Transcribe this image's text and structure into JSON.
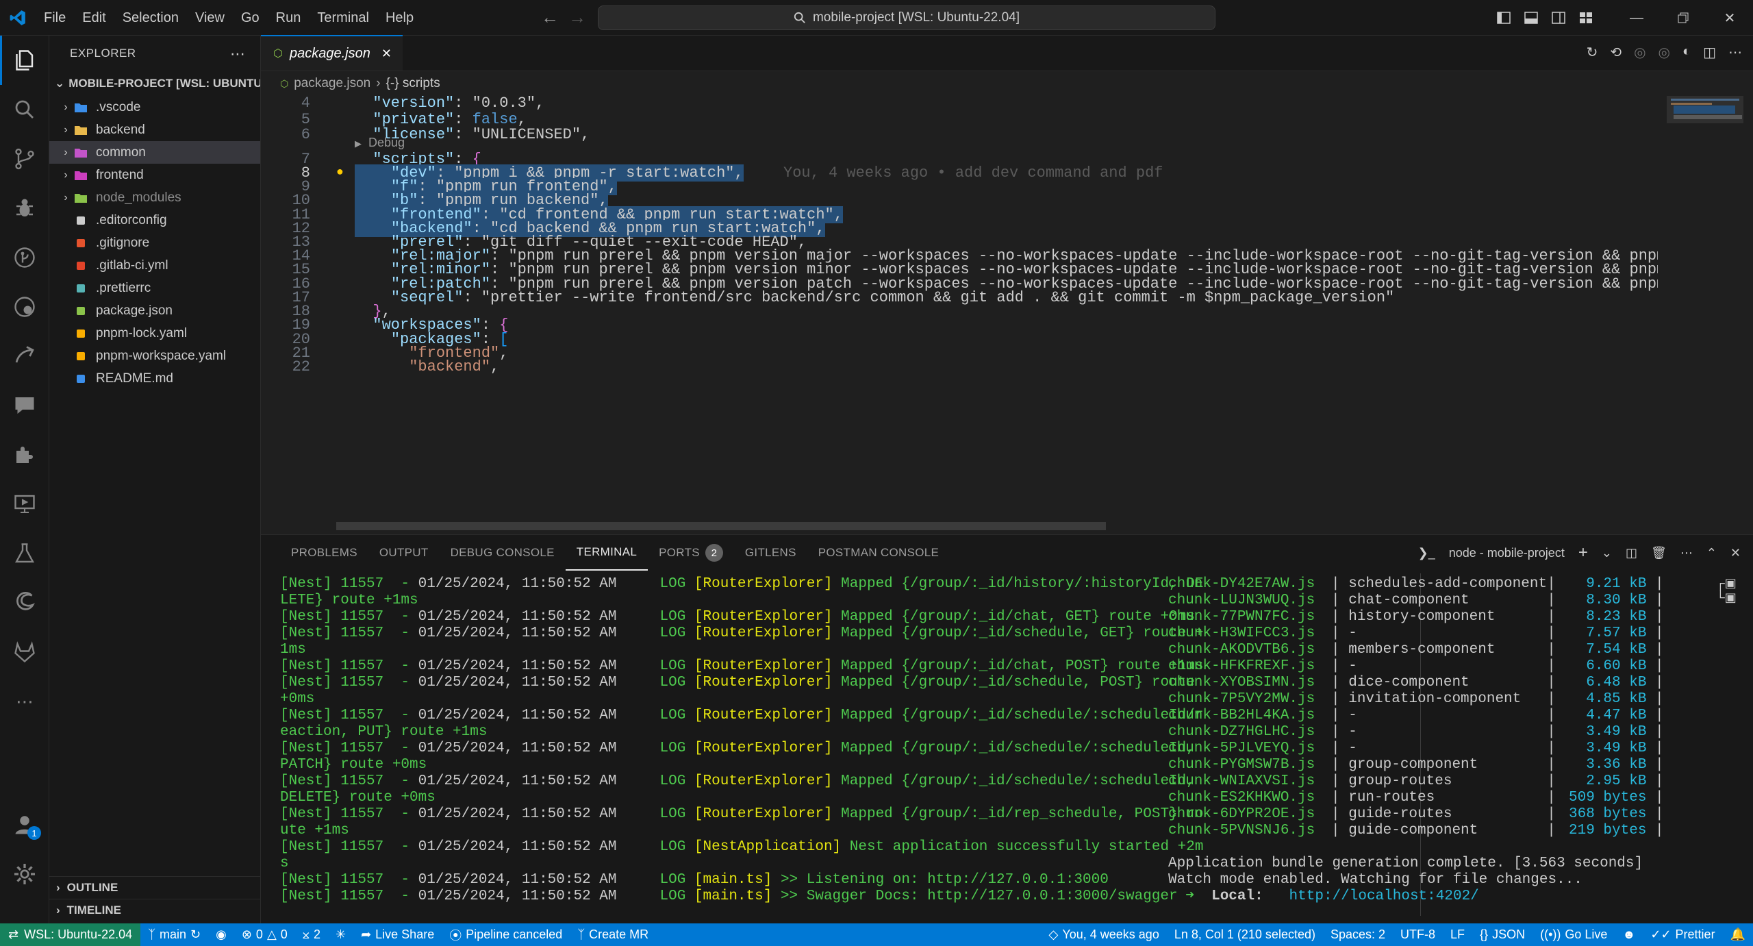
{
  "titlebar": {
    "menus": [
      "File",
      "Edit",
      "Selection",
      "View",
      "Go",
      "Run",
      "Terminal",
      "Help"
    ],
    "search": "mobile-project [WSL: Ubuntu-22.04]"
  },
  "sidebar": {
    "title": "EXPLORER",
    "root": "MOBILE-PROJECT [WSL: UBUNTU...",
    "items": [
      {
        "label": ".vscode",
        "type": "folder",
        "icon": "vscode-folder-icon",
        "color": "#3b8eea"
      },
      {
        "label": "backend",
        "type": "folder",
        "icon": "folder-icon",
        "color": "#e8b84b"
      },
      {
        "label": "common",
        "type": "folder",
        "icon": "folder-icon",
        "color": "#c354c9"
      },
      {
        "label": "frontend",
        "type": "folder",
        "icon": "folder-icon",
        "color": "#cc3ebe"
      },
      {
        "label": "node_modules",
        "type": "folder",
        "icon": "node-folder-icon",
        "color": "#8bc34a"
      },
      {
        "label": ".editorconfig",
        "type": "file",
        "icon": "editorconfig-icon",
        "color": "#cccccc"
      },
      {
        "label": ".gitignore",
        "type": "file",
        "icon": "git-icon",
        "color": "#e5532d"
      },
      {
        "label": ".gitlab-ci.yml",
        "type": "file",
        "icon": "gitlab-icon",
        "color": "#e24329"
      },
      {
        "label": ".prettierrc",
        "type": "file",
        "icon": "prettier-icon",
        "color": "#56b3b4"
      },
      {
        "label": "package.json",
        "type": "file",
        "icon": "nodejs-icon",
        "color": "#8bc34a"
      },
      {
        "label": "pnpm-lock.yaml",
        "type": "file",
        "icon": "pnpm-icon",
        "color": "#f9ad00"
      },
      {
        "label": "pnpm-workspace.yaml",
        "type": "file",
        "icon": "pnpm-icon",
        "color": "#f9ad00"
      },
      {
        "label": "README.md",
        "type": "file",
        "icon": "info-icon",
        "color": "#3b8eea"
      }
    ],
    "outline": "OUTLINE",
    "timeline": "TIMELINE"
  },
  "editor": {
    "tab": "package.json",
    "breadcrumb": [
      "package.json",
      "{-} scripts"
    ],
    "codelens": "Debug",
    "blame": "You, 4 weeks ago • add dev command and pdf"
  },
  "code": [
    {
      "n": "4",
      "t": "  \"version\": \"0.0.3\","
    },
    {
      "n": "5",
      "t": "  \"private\": false,"
    },
    {
      "n": "6",
      "t": "  \"license\": \"UNLICENSED\","
    },
    {
      "n": "7",
      "t": "  \"scripts\": {"
    },
    {
      "n": "8",
      "t": "    \"dev\": \"pnpm i && pnpm -r start:watch\","
    },
    {
      "n": "9",
      "t": "    \"f\": \"pnpm run frontend\","
    },
    {
      "n": "10",
      "t": "    \"b\": \"pnpm run backend\","
    },
    {
      "n": "11",
      "t": "    \"frontend\": \"cd frontend && pnpm run start:watch\","
    },
    {
      "n": "12",
      "t": "    \"backend\": \"cd backend && pnpm run start:watch\","
    },
    {
      "n": "13",
      "t": "    \"prerel\": \"git diff --quiet --exit-code HEAD\","
    },
    {
      "n": "14",
      "t": "    \"rel:major\": \"pnpm run prerel && pnpm version major --workspaces --no-workspaces-update --include-workspace-root --no-git-tag-version && pnpm"
    },
    {
      "n": "15",
      "t": "    \"rel:minor\": \"pnpm run prerel && pnpm version minor --workspaces --no-workspaces-update --include-workspace-root --no-git-tag-version && pnpm"
    },
    {
      "n": "16",
      "t": "    \"rel:patch\": \"pnpm run prerel && pnpm version patch --workspaces --no-workspaces-update --include-workspace-root --no-git-tag-version && pnpm"
    },
    {
      "n": "17",
      "t": "    \"seqrel\": \"prettier --write frontend/src backend/src common && git add . && git commit -m $npm_package_version\""
    },
    {
      "n": "18",
      "t": "  },"
    },
    {
      "n": "19",
      "t": "  \"workspaces\": {"
    },
    {
      "n": "20",
      "t": "    \"packages\": ["
    },
    {
      "n": "21",
      "t": "      \"frontend\","
    },
    {
      "n": "22",
      "t": "      \"backend\","
    }
  ],
  "panel": {
    "tabs": [
      "PROBLEMS",
      "OUTPUT",
      "DEBUG CONSOLE",
      "TERMINAL",
      "PORTS",
      "GITLENS",
      "POSTMAN CONSOLE"
    ],
    "ports_count": "2",
    "terminal_name": "node - mobile-project"
  },
  "terminal_left": [
    "[Nest] 11557  - 01/25/2024, 11:50:52 AM     LOG [RouterExplorer] Mapped {/group/:_id/history/:historyId, DE",
    "LETE} route +1ms",
    "[Nest] 11557  - 01/25/2024, 11:50:52 AM     LOG [RouterExplorer] Mapped {/group/:_id/chat, GET} route +0ms",
    "[Nest] 11557  - 01/25/2024, 11:50:52 AM     LOG [RouterExplorer] Mapped {/group/:_id/schedule, GET} route +",
    "1ms",
    "[Nest] 11557  - 01/25/2024, 11:50:52 AM     LOG [RouterExplorer] Mapped {/group/:_id/chat, POST} route +1ms",
    "[Nest] 11557  - 01/25/2024, 11:50:52 AM     LOG [RouterExplorer] Mapped {/group/:_id/schedule, POST} route",
    "+0ms",
    "[Nest] 11557  - 01/25/2024, 11:50:52 AM     LOG [RouterExplorer] Mapped {/group/:_id/schedule/:scheduleId/r",
    "eaction, PUT} route +1ms",
    "[Nest] 11557  - 01/25/2024, 11:50:52 AM     LOG [RouterExplorer] Mapped {/group/:_id/schedule/:scheduleId,",
    "PATCH} route +0ms",
    "[Nest] 11557  - 01/25/2024, 11:50:52 AM     LOG [RouterExplorer] Mapped {/group/:_id/schedule/:scheduleId,",
    "DELETE} route +0ms",
    "[Nest] 11557  - 01/25/2024, 11:50:52 AM     LOG [RouterExplorer] Mapped {/group/:_id/rep_schedule, POST} ro",
    "ute +1ms",
    "[Nest] 11557  - 01/25/2024, 11:50:52 AM     LOG [NestApplication] Nest application successfully started +2m",
    "s",
    "[Nest] 11557  - 01/25/2024, 11:50:52 AM     LOG [main.ts] >> Listening on: http://127.0.0.1:3000",
    "[Nest] 11557  - 01/25/2024, 11:50:52 AM     LOG [main.ts] >> Swagger Docs: http://127.0.0.1:3000/swagger"
  ],
  "terminal_right": {
    "chunks": [
      [
        "chunk-DY42E7AW.js",
        "schedules-add-component",
        "9.21 kB"
      ],
      [
        "chunk-LUJN3WUQ.js",
        "chat-component",
        "8.30 kB"
      ],
      [
        "chunk-77PWN7FC.js",
        "history-component",
        "8.23 kB"
      ],
      [
        "chunk-H3WIFCC3.js",
        "-",
        "7.57 kB"
      ],
      [
        "chunk-AKODVTB6.js",
        "members-component",
        "7.54 kB"
      ],
      [
        "chunk-HFKFREXF.js",
        "-",
        "6.60 kB"
      ],
      [
        "chunk-XYOBSIMN.js",
        "dice-component",
        "6.48 kB"
      ],
      [
        "chunk-7P5VY2MW.js",
        "invitation-component",
        "4.85 kB"
      ],
      [
        "chunk-BB2HL4KA.js",
        "-",
        "4.47 kB"
      ],
      [
        "chunk-DZ7HGLHC.js",
        "-",
        "3.49 kB"
      ],
      [
        "chunk-5PJLVEYQ.js",
        "-",
        "3.49 kB"
      ],
      [
        "chunk-PYGMSW7B.js",
        "group-component",
        "3.36 kB"
      ],
      [
        "chunk-WNIAXVSI.js",
        "group-routes",
        "2.95 kB"
      ],
      [
        "chunk-ES2KHKWO.js",
        "run-routes",
        "509 bytes"
      ],
      [
        "chunk-6DYPR2OE.js",
        "guide-routes",
        "368 bytes"
      ],
      [
        "chunk-5PVNSNJ6.js",
        "guide-component",
        "219 bytes"
      ]
    ],
    "complete": "Application bundle generation complete. [3.563 seconds]",
    "watch": "Watch mode enabled. Watching for file changes...",
    "local_label": "Local:",
    "local_url": "http://localhost:4202/"
  },
  "statusbar": {
    "remote": "WSL: Ubuntu-22.04",
    "branch": "main",
    "errors": "0",
    "warnings": "0",
    "ports": "2",
    "live_share": "Live Share",
    "pipeline": "Pipeline canceled",
    "create_mr": "Create MR",
    "blame": "You, 4 weeks ago",
    "position": "Ln 8, Col 1 (210 selected)",
    "spaces": "Spaces: 2",
    "encoding": "UTF-8",
    "eol": "LF",
    "language": "JSON",
    "go_live": "Go Live",
    "prettier": "Prettier"
  }
}
